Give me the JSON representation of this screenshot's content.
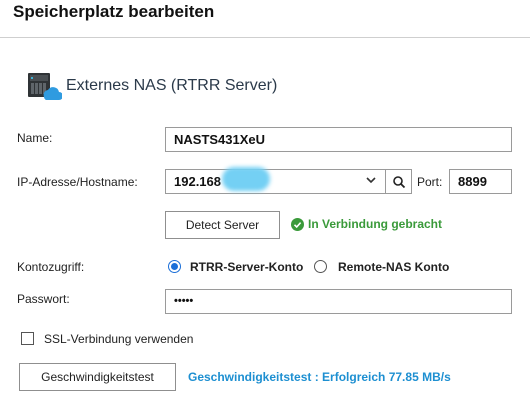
{
  "dialog": {
    "title": "Speicherplatz bearbeiten"
  },
  "section": {
    "title": "Externes NAS (RTRR Server)",
    "icon": "nas-server-cloud-icon"
  },
  "form": {
    "name": {
      "label": "Name:",
      "value": "NASTS431XeU"
    },
    "ip": {
      "label": "IP-Adresse/Hostname:",
      "value": "192.168"
    },
    "port": {
      "label": "Port:",
      "value": "8899"
    },
    "detect_button": "Detect Server",
    "status": {
      "text": "In Verbindung gebracht",
      "color": "#3a9a3a"
    },
    "account": {
      "label": "Kontozugriff:",
      "options": [
        "RTRR-Server-Konto",
        "Remote-NAS Konto"
      ],
      "selected": "RTRR-Server-Konto"
    },
    "password": {
      "label": "Passwort:",
      "value": "•••••"
    },
    "ssl": {
      "label": "SSL-Verbindung verwenden",
      "checked": false
    },
    "speed_test_button": "Geschwindigkeitstest",
    "speed_result": "Geschwindigkeitstest : Erfolgreich 77.85 MB/s"
  },
  "colors": {
    "accent": "#1b6fd8",
    "link": "#1d8fd1",
    "success": "#3a9a3a"
  }
}
